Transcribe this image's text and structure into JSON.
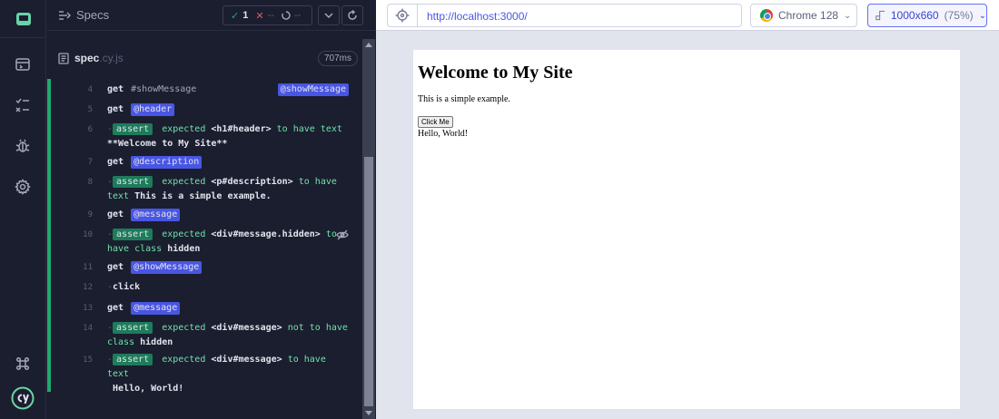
{
  "header": {
    "specs_label": "Specs",
    "passed": "1",
    "failed": "--",
    "pending": "--"
  },
  "spec": {
    "name": "spec",
    "ext": ".cy.js",
    "duration": "707ms"
  },
  "commands": [
    {
      "n": "4"
    },
    {
      "n": "5"
    },
    {
      "n": "6"
    },
    {
      "n": "7"
    },
    {
      "n": "8"
    },
    {
      "n": "9"
    },
    {
      "n": "10"
    },
    {
      "n": "11"
    },
    {
      "n": "12"
    },
    {
      "n": "13"
    },
    {
      "n": "14"
    },
    {
      "n": "15"
    }
  ],
  "text": {
    "get": "get",
    "assert": "assert",
    "expected": "expected",
    "click": "click",
    "alias_showmessage": "@showMessage",
    "alias_header": "@header",
    "alias_description": "@description",
    "alias_message": "@message",
    "plain_showmessage": "#showMessage",
    "c6_el": "<h1#header>",
    "c6_rest": "to have text",
    "c6_val": "**Welcome to My Site**",
    "c8_el": "<p#description>",
    "c8_rest": "to have",
    "c8_rest2": "text",
    "c8_val": "This is a simple example.",
    "c10_el": "<div#message.hidden>",
    "c10_rest": "to",
    "c10_rest2": "have class",
    "c10_val": "hidden",
    "c14_el": "<div#message>",
    "c14_rest": "not to have",
    "c14_rest2": "class",
    "c14_val": "hidden",
    "c15_el": "<div#message>",
    "c15_rest": "to have text",
    "c15_val": "Hello, World!"
  },
  "aut_bar": {
    "url": "http://localhost:3000/",
    "browser": "Chrome 128",
    "viewport": "1000x660",
    "scale": "(75%)"
  },
  "aut_page": {
    "heading": "Welcome to My Site",
    "description": "This is a simple example.",
    "button": "Click Me",
    "message": "Hello, World!"
  }
}
